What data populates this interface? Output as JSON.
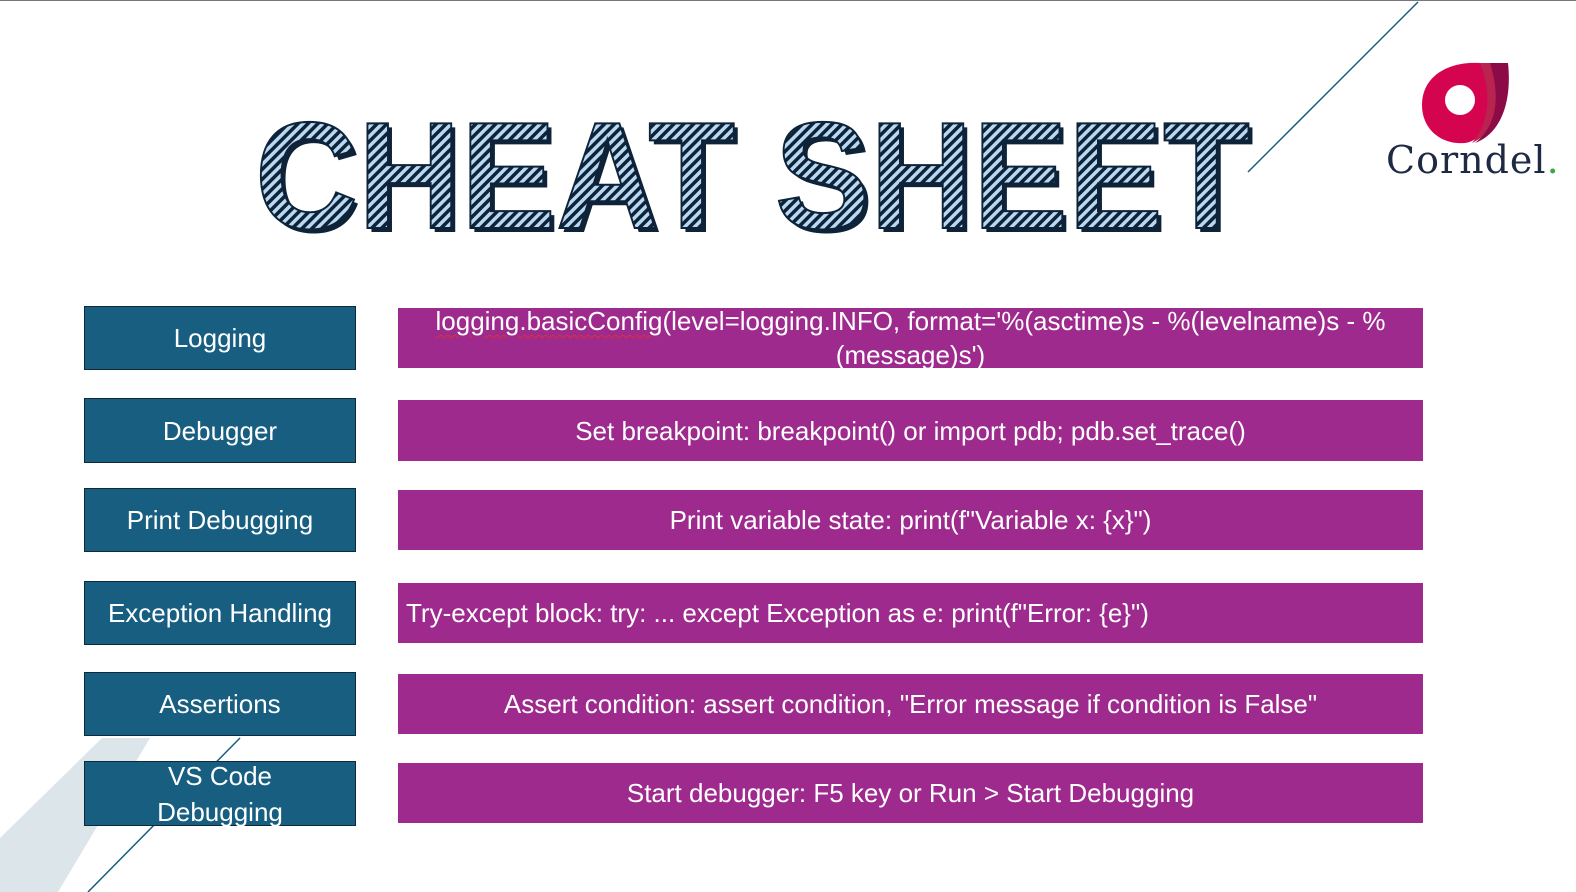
{
  "title": "CHEAT SHEET",
  "logo": {
    "name": "Corndel",
    "dot": "."
  },
  "colors": {
    "label_bg": "#175e80",
    "desc_bg": "#9e2a8e",
    "title_dark": "#0e2238",
    "title_stripe": "#b9d8f2",
    "logo_red": "#d4044f",
    "logo_green": "#3aa845"
  },
  "rows": [
    {
      "label": "Logging",
      "desc_prefix": "logging.basicConfig",
      "desc": "(level=logging.INFO, format='%(asctime)s - %(levelname)s - %(message)s')"
    },
    {
      "label": "Debugger",
      "desc": "Set breakpoint: breakpoint() or import pdb; pdb.set_trace()"
    },
    {
      "label": "Print Debugging",
      "desc": "Print variable state: print(f\"Variable x: {x}\")"
    },
    {
      "label": "Exception Handling",
      "desc": "Try-except block: try: ... except Exception as e: print(f\"Error: {e}\")"
    },
    {
      "label": "Assertions",
      "desc": "Assert condition: assert condition, \"Error message if condition is False\""
    },
    {
      "label": "VS Code Debugging",
      "desc": "Start debugger: F5 key or Run > Start Debugging"
    }
  ]
}
